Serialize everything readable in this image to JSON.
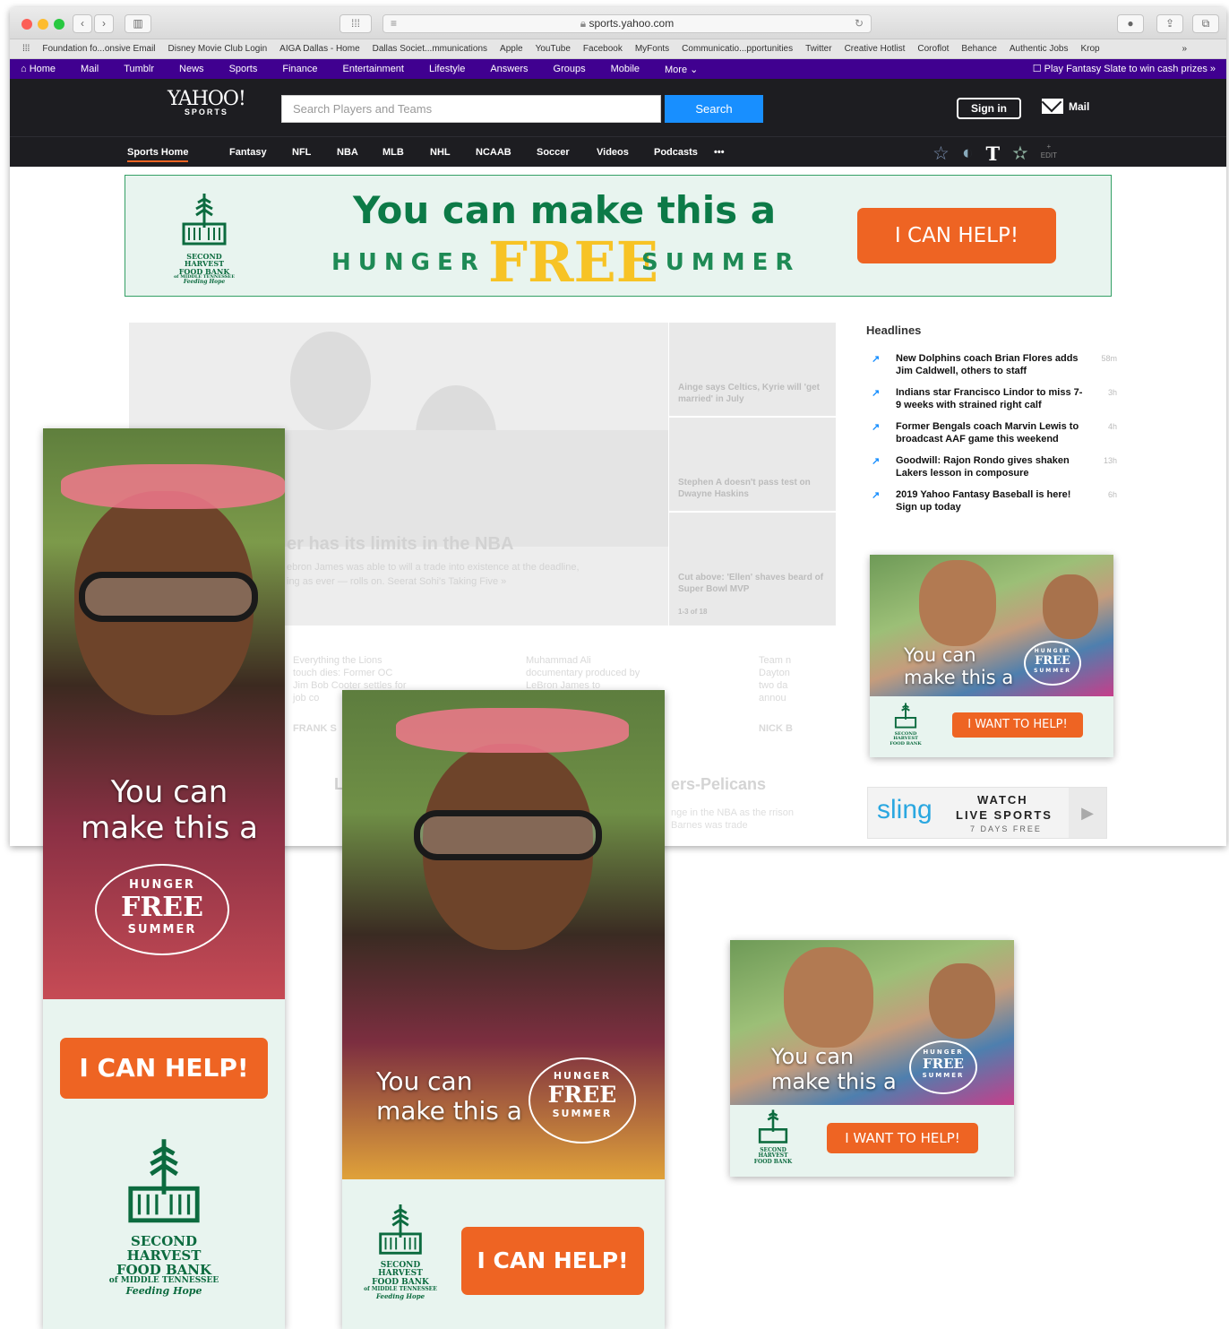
{
  "browser": {
    "url": "sports.yahoo.com",
    "bookmarks": [
      "Foundation fo...onsive Email",
      "Disney Movie Club Login",
      "AIGA Dallas - Home",
      "Dallas Societ...mmunications",
      "Apple",
      "YouTube",
      "Facebook",
      "MyFonts",
      "Communicatio...pportunities",
      "Twitter",
      "Creative Hotlist",
      "Coroflot",
      "Behance",
      "Authentic Jobs",
      "Krop"
    ]
  },
  "yahoo_nav": {
    "items": [
      "Home",
      "Mail",
      "Tumblr",
      "News",
      "Sports",
      "Finance",
      "Entertainment",
      "Lifestyle",
      "Answers",
      "Groups",
      "Mobile",
      "More"
    ],
    "promo": "Play Fantasy Slate to win cash prizes »"
  },
  "header": {
    "logo": "YAHOO!",
    "logo_sub": "SPORTS",
    "search_placeholder": "Search Players and Teams",
    "search_button": "Search",
    "sign_in": "Sign in",
    "mail": "Mail"
  },
  "sports_nav": {
    "items": [
      "Sports Home",
      "Fantasy",
      "NFL",
      "NBA",
      "MLB",
      "NHL",
      "NCAAB",
      "Soccer",
      "Videos",
      "Podcasts",
      "•••"
    ],
    "edit": "EDIT"
  },
  "banner_ad": {
    "line1": "You can make this a",
    "hunger": "HUNGER",
    "free": "FREE",
    "summer": "SUMMER",
    "button": "I CAN HELP!"
  },
  "hero": {
    "title": "er has its limits in the NBA",
    "line1": "ebron James was able to will a trade into existence at the deadline,",
    "line2": "ing as ever — rolls on. Seerat Sohi's Taking Five »",
    "side_stories": [
      "Ainge says Celtics, Kyrie will 'get married' in July",
      "Stephen A doesn't pass test on Dwayne Haskins",
      "Cut above: 'Ellen' shaves beard of Super Bowl MVP"
    ],
    "pager": "1-3 of 18"
  },
  "below_strip": {
    "s1": "Everything the Lions touch dies: Former OC Jim Bob Cooter settles for job co",
    "s2": "Muhammad Ali documentary produced by LeBron James to",
    "s3": "Team n Dayton two da annou",
    "tag1": "FRANK S",
    "tag2": "NICK B",
    "feature_title": "Le",
    "feature_right": "ers-Pelicans",
    "feature_snip": "nge in the NBA as the rrison Barnes was trade"
  },
  "headlines": {
    "title": "Headlines",
    "items": [
      {
        "text": "New Dolphins coach Brian Flores adds Jim Caldwell, others to staff",
        "age": "58m"
      },
      {
        "text": "Indians star Francisco Lindor to miss 7-9 weeks with strained right calf",
        "age": "3h"
      },
      {
        "text": "Former Bengals coach Marvin Lewis to broadcast AAF game this weekend",
        "age": "4h"
      },
      {
        "text": "Goodwill: Rajon Rondo gives shaken Lakers lesson in composure",
        "age": "13h"
      },
      {
        "text": "2019 Yahoo Fantasy Baseball is here! Sign up today",
        "age": "6h"
      }
    ]
  },
  "ads": {
    "headline_l1": "You can",
    "headline_l2": "make this a",
    "badge_top": "HUNGER",
    "badge_mid": "FREE",
    "badge_bot": "SUMMER",
    "cta_can": "I CAN HELP!",
    "cta_want": "I WANT TO HELP!",
    "org_l1": "SECOND HARVEST",
    "org_l2": "FOOD BANK",
    "org_l3": "of MIDDLE TENNESSEE",
    "org_tag": "Feeding Hope"
  },
  "sling": {
    "brand": "sling",
    "l1": "WATCH",
    "l2": "LIVE SPORTS",
    "l3": "7 DAYS FREE"
  },
  "colors": {
    "yahoo_purple": "#400090",
    "header_dark": "#1d1d21",
    "search_blue": "#188fff",
    "ad_orange": "#ee6423",
    "ad_green": "#0c7a47",
    "ad_mint": "#e8f4ef",
    "free_yellow": "#f7c325"
  }
}
